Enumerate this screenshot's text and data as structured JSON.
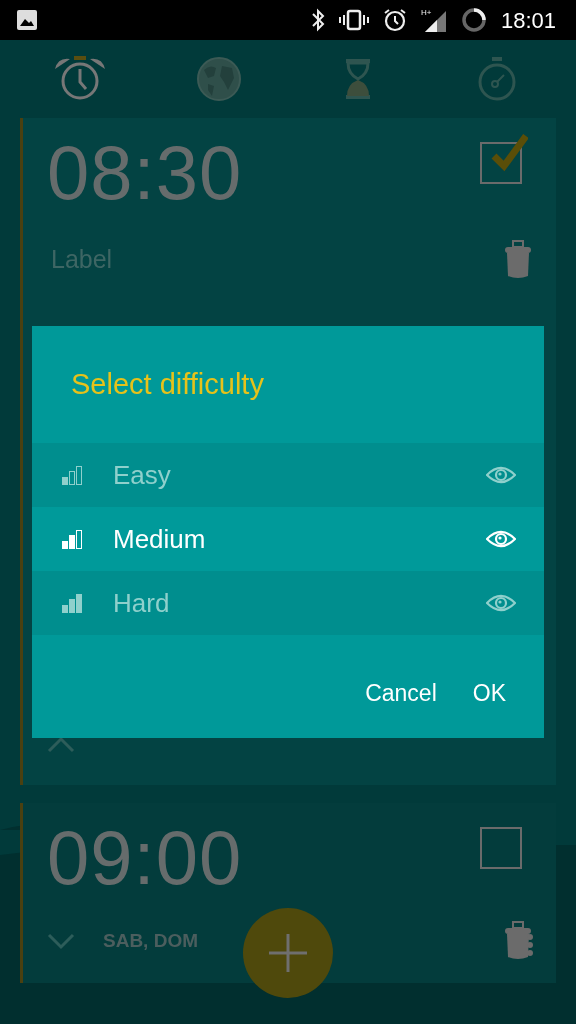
{
  "status_bar": {
    "time": "18:01",
    "network": "H+"
  },
  "tabs": [
    {
      "kind": "alarm",
      "selected": true
    },
    {
      "kind": "world",
      "selected": false
    },
    {
      "kind": "timer",
      "selected": false
    },
    {
      "kind": "stopwatch",
      "selected": false
    }
  ],
  "alarms": [
    {
      "time": "08:30",
      "enabled": true,
      "expanded": true,
      "label_placeholder": "Label"
    },
    {
      "time": "09:00",
      "enabled": false,
      "expanded": false,
      "days": "SAB, DOM"
    }
  ],
  "dialog": {
    "title": "Select difficulty",
    "options": [
      {
        "label": "Easy",
        "kind": "easy",
        "selected": false
      },
      {
        "label": "Medium",
        "kind": "medium",
        "selected": true
      },
      {
        "label": "Hard",
        "kind": "hard",
        "selected": false
      }
    ],
    "buttons": [
      "Cancel",
      "OK"
    ]
  }
}
